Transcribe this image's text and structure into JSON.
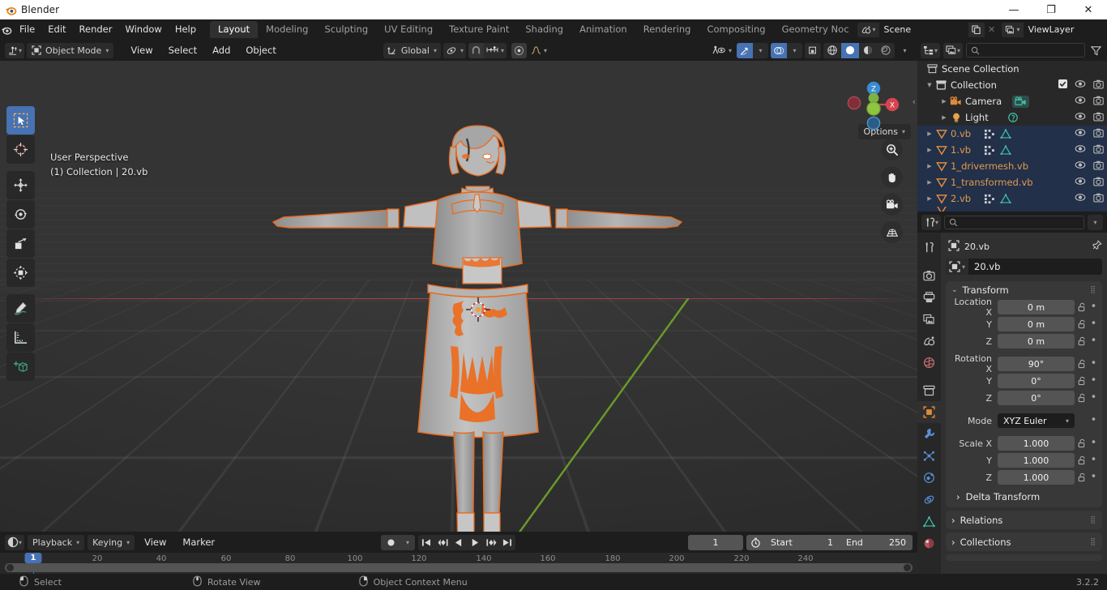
{
  "window": {
    "title": "Blender",
    "app_icon": "blender-logo-icon",
    "minimize": "—",
    "maximize": "❐",
    "close": "✕"
  },
  "topbar": {
    "menus": [
      "File",
      "Edit",
      "Render",
      "Window",
      "Help"
    ],
    "workspaces": [
      {
        "label": "Layout",
        "active": true
      },
      {
        "label": "Modeling",
        "active": false
      },
      {
        "label": "Sculpting",
        "active": false
      },
      {
        "label": "UV Editing",
        "active": false
      },
      {
        "label": "Texture Paint",
        "active": false
      },
      {
        "label": "Shading",
        "active": false
      },
      {
        "label": "Animation",
        "active": false
      },
      {
        "label": "Rendering",
        "active": false
      },
      {
        "label": "Compositing",
        "active": false
      },
      {
        "label": "Geometry Noc",
        "active": false
      }
    ],
    "scene": {
      "label": "Scene",
      "icon": "scene-icon",
      "new_icon": "copy-icon",
      "unlink_icon": "x-icon"
    },
    "viewlayer": {
      "label": "ViewLayer",
      "icon": "viewlayer-icon",
      "new_icon": "copy-icon",
      "unlink_icon": "x-icon"
    }
  },
  "viewport_header": {
    "editor_type_icon": "editor-type-icon",
    "mode": "Object Mode",
    "menus": [
      "View",
      "Select",
      "Add",
      "Object"
    ],
    "transform_orientation": "Global",
    "pivot_icon": "pivot-point-icon",
    "snap_icon": "snap-magnet-icon",
    "snap_to_icon": "snap-increment-icon",
    "proportional_icon": "proportional-edit-icon",
    "falloff_icon": "falloff-curve-icon",
    "visibility_icon": "object-types-visibility-icon",
    "gizmo_icon": "gizmo-icon",
    "overlays_icon": "overlays-icon",
    "xray_icon": "xray-toggle-icon",
    "shading_modes": [
      "wireframe",
      "solid",
      "material-preview",
      "rendered"
    ],
    "shading_active": "solid",
    "options_label": "Options"
  },
  "viewport": {
    "overlay_line1": "User Perspective",
    "overlay_line2": "(1) Collection | 20.vb",
    "gizmo_axes": [
      "X",
      "Z"
    ],
    "nav_buttons": [
      "zoom-icon",
      "pan-hand-icon",
      "camera-view-icon",
      "toggle-ortho-grid-icon"
    ],
    "sidebar_toggle": "‹",
    "selection_color": "#ed6a1b",
    "background_color": "#303030"
  },
  "toolbar": {
    "tools": [
      {
        "name": "tweak-select-box-tool",
        "active": true
      },
      {
        "name": "cursor-tool",
        "active": false
      },
      {
        "name": "move-tool",
        "active": false
      },
      {
        "name": "rotate-tool",
        "active": false
      },
      {
        "name": "scale-tool",
        "active": false
      },
      {
        "name": "transform-tool",
        "active": false
      },
      {
        "name": "annotate-tool",
        "active": false
      },
      {
        "name": "measure-tool",
        "active": false
      },
      {
        "name": "add-cube-tool",
        "active": false
      }
    ]
  },
  "outliner": {
    "display_mode_icon": "outliner-display-mode-icon",
    "filter_scene_icon": "viewlayer-icon",
    "search_placeholder": "",
    "filter_icon": "filter-funnel-icon",
    "rows": [
      {
        "label": "Scene Collection",
        "icon": "scene-collection-icon",
        "indent": 0,
        "expander": "",
        "selected": false,
        "type": "collection",
        "checkbox": false,
        "hide": false,
        "render": false
      },
      {
        "label": "Collection",
        "icon": "collection-icon",
        "indent": 1,
        "expander": "▼",
        "selected": false,
        "type": "collection",
        "checkbox": true,
        "hide": true,
        "render": true
      },
      {
        "label": "Camera",
        "icon": "camera-object-icon",
        "indent": 2,
        "expander": "▶",
        "selected": false,
        "type": "object",
        "data_icon": "camera-data-icon",
        "hide": true,
        "render": true
      },
      {
        "label": "Light",
        "icon": "light-object-icon",
        "indent": 2,
        "expander": "▶",
        "selected": false,
        "type": "object",
        "data_icon": "light-data-icon",
        "hide": true,
        "render": true
      },
      {
        "label": "0.vb",
        "icon": "mesh-object-icon",
        "indent": 1,
        "expander": "▶",
        "selected": true,
        "type": "object",
        "modifier_icon": "modifier-icon",
        "data_icon": "mesh-data-icon",
        "hide": true,
        "render": true
      },
      {
        "label": "1.vb",
        "icon": "mesh-object-icon",
        "indent": 1,
        "expander": "▶",
        "selected": true,
        "type": "object",
        "modifier_icon": "modifier-icon",
        "data_icon": "mesh-data-icon",
        "hide": true,
        "render": true
      },
      {
        "label": "1_drivermesh.vb",
        "icon": "mesh-object-icon",
        "indent": 1,
        "expander": "▶",
        "selected": true,
        "type": "object",
        "hide": true,
        "render": true
      },
      {
        "label": "1_transformed.vb",
        "icon": "mesh-object-icon",
        "indent": 1,
        "expander": "▶",
        "selected": true,
        "type": "object",
        "hide": true,
        "render": true
      },
      {
        "label": "2.vb",
        "icon": "mesh-object-icon",
        "indent": 1,
        "expander": "▶",
        "selected": true,
        "type": "object",
        "modifier_icon": "modifier-icon",
        "data_icon": "mesh-data-icon",
        "hide": true,
        "render": true
      }
    ]
  },
  "properties": {
    "editor_icon": "properties-editor-icon",
    "search_placeholder": "",
    "breadcrumb_icon": "object-properties-icon",
    "breadcrumb_label": "20.vb",
    "pin_icon": "pin-icon",
    "object_name": "20.vb",
    "tabs": [
      {
        "name": "tool-tab",
        "active": false
      },
      {
        "name": "render-tab",
        "active": false
      },
      {
        "name": "output-tab",
        "active": false
      },
      {
        "name": "view-layer-tab",
        "active": false
      },
      {
        "name": "scene-tab",
        "active": false
      },
      {
        "name": "world-tab",
        "active": false
      },
      {
        "name": "collection-tab",
        "active": false
      },
      {
        "name": "object-tab",
        "active": true
      },
      {
        "name": "modifier-tab",
        "active": false
      },
      {
        "name": "particles-tab",
        "active": false
      },
      {
        "name": "physics-tab",
        "active": false
      },
      {
        "name": "constraints-tab",
        "active": false
      },
      {
        "name": "object-data-tab",
        "active": false
      },
      {
        "name": "material-tab",
        "active": false
      }
    ],
    "transform": {
      "title": "Transform",
      "rows": [
        {
          "label": "Location X",
          "value": "0 m"
        },
        {
          "label": "Y",
          "value": "0 m"
        },
        {
          "label": "Z",
          "value": "0 m"
        },
        {
          "label": "Rotation X",
          "value": "90°"
        },
        {
          "label": "Y",
          "value": "0°"
        },
        {
          "label": "Z",
          "value": "0°"
        },
        {
          "label": "Mode",
          "value": "XYZ Euler",
          "dropdown": true
        },
        {
          "label": "Scale X",
          "value": "1.000"
        },
        {
          "label": "Y",
          "value": "1.000"
        },
        {
          "label": "Z",
          "value": "1.000"
        }
      ]
    },
    "closed_panels": [
      "Delta Transform",
      "Relations",
      "Collections"
    ]
  },
  "timeline": {
    "editor_icon": "timeline-editor-icon",
    "menus": [
      "Playback",
      "Keying",
      "View",
      "Marker"
    ],
    "record_icon": "record-keyframe-icon",
    "transport": [
      "jump-to-start-icon",
      "jump-to-prev-keyframe-icon",
      "play-reverse-icon",
      "play-icon",
      "jump-to-next-keyframe-icon",
      "jump-to-end-icon"
    ],
    "current_frame": "1",
    "timer_icon": "auto-keying-icon",
    "start_label": "Start",
    "start_value": "1",
    "end_label": "End",
    "end_value": "250",
    "ticks": [
      "20",
      "40",
      "60",
      "80",
      "100",
      "120",
      "140",
      "160",
      "180",
      "200",
      "220",
      "240"
    ],
    "playhead_label": "1"
  },
  "statusbar": {
    "items": [
      {
        "icon": "mouse-left-icon",
        "label": "Select"
      },
      {
        "icon": "mouse-middle-icon",
        "label": "Rotate View"
      },
      {
        "icon": "mouse-right-icon",
        "label": "Object Context Menu"
      }
    ],
    "version": "3.2.2"
  }
}
